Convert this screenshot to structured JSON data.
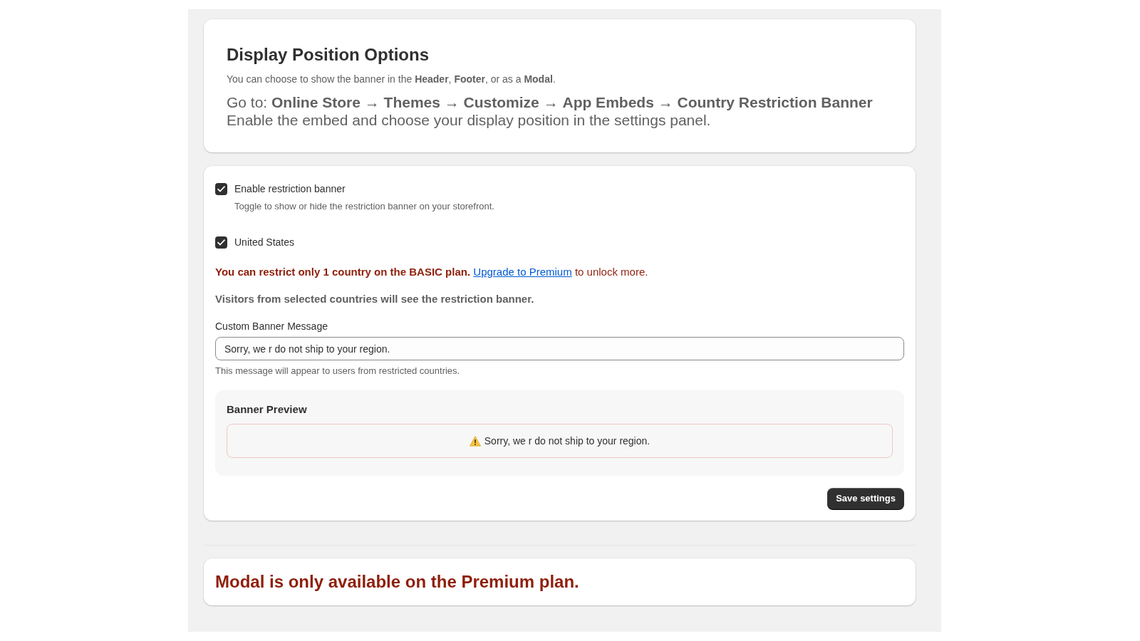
{
  "display_position": {
    "title": "Display Position Options",
    "description": "You can choose to show the banner in the **Header**, **Footer**, or as a **Modal**.",
    "instructions": "Go to: **Online Store** → **Themes** → **Customize** → **App Embeds** → **Country Restriction Banner**",
    "note": "Enable the embed and choose your display position in the settings panel."
  },
  "settings": {
    "enable_banner": {
      "label": "Enable restriction banner",
      "help": "Toggle to show or hide the restriction banner on your storefront.",
      "checked": true
    },
    "countries": [
      {
        "label": "United States",
        "checked": true
      }
    ],
    "plan_warning": {
      "lead": "You can restrict only 1 country on the BASIC plan.",
      "link": "Upgrade to Premium",
      "tail": "to unlock more."
    },
    "visitors_note": "Visitors from selected countries will see the restriction banner.",
    "message_field": {
      "label": "Custom Banner Message",
      "value": "Sorry, we r do not ship to your region.",
      "help": "This message will appear to users from restricted countries."
    },
    "preview": {
      "title": "Banner Preview",
      "message": "Sorry, we r do not ship to your region."
    },
    "save_button": "Save settings"
  },
  "modal_notice": "Modal is only available on the Premium plan."
}
